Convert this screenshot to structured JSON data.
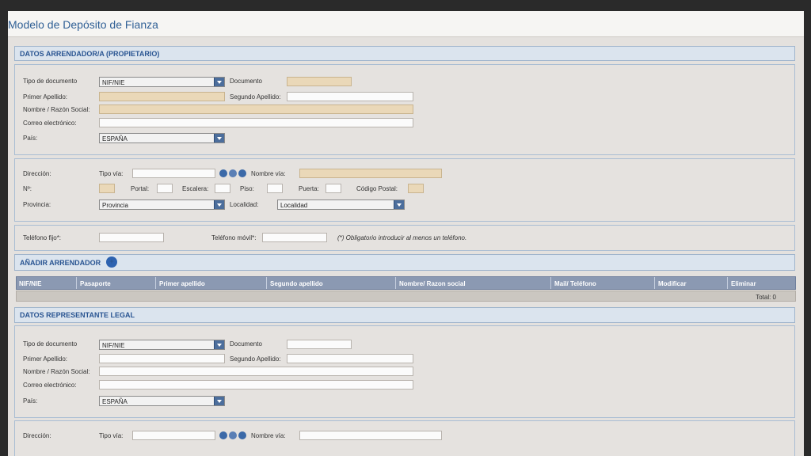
{
  "title": "Modelo de Depósito de Fianza",
  "arrendador": {
    "section_title": "DATOS ARRENDADOR/A (PROPIETARIO)",
    "tipo_documento_label": "Tipo de documento",
    "tipo_documento_value": "NIF/NIE",
    "documento_label": "Documento",
    "primer_apellido_label": "Primer Apellido:",
    "segundo_apellido_label": "Segundo Apellido:",
    "nombre_label": "Nombre / Razón Social:",
    "correo_label": "Correo electrónico:",
    "pais_label": "País:",
    "pais_value": "ESPAÑA",
    "direccion_label": "Dirección:",
    "tipo_via_label": "Tipo vía:",
    "nombre_via_label": "Nombre vía:",
    "numero_label": "Nº:",
    "portal_label": "Portal:",
    "escalera_label": "Escalera:",
    "piso_label": "Piso:",
    "puerta_label": "Puerta:",
    "codigo_postal_label": "Código Postal:",
    "provincia_label": "Provincia:",
    "provincia_value": "Provincia",
    "localidad_label": "Localidad:",
    "localidad_value": "Localidad",
    "telefono_fijo_label": "Teléfono fijo*:",
    "telefono_movil_label": "Teléfono móvil*:",
    "telefono_note": "(*) Obligatorio introducir al menos un teléfono."
  },
  "add_arrendador_label": "AÑADIR ARRENDADOR",
  "table": {
    "columns": [
      "NIF/NIE",
      "Pasaporte",
      "Primer apellido",
      "Segundo apellido",
      "Nombre/ Razon social",
      "Mail/ Teléfono",
      "Modificar",
      "Eliminar"
    ],
    "total": "Total: 0"
  },
  "representante": {
    "section_title": "DATOS REPRESENTANTE LEGAL",
    "tipo_documento_label": "Tipo de documento",
    "tipo_documento_value": "NIF/NIE",
    "documento_label": "Documento",
    "primer_apellido_label": "Primer Apellido:",
    "segundo_apellido_label": "Segundo Apellido:",
    "nombre_label": "Nombre / Razón Social:",
    "correo_label": "Correo electrónico:",
    "pais_label": "País:",
    "pais_value": "ESPAÑA",
    "direccion_label": "Dirección:",
    "tipo_via_label": "Tipo vía:",
    "nombre_via_label": "Nombre vía:"
  }
}
